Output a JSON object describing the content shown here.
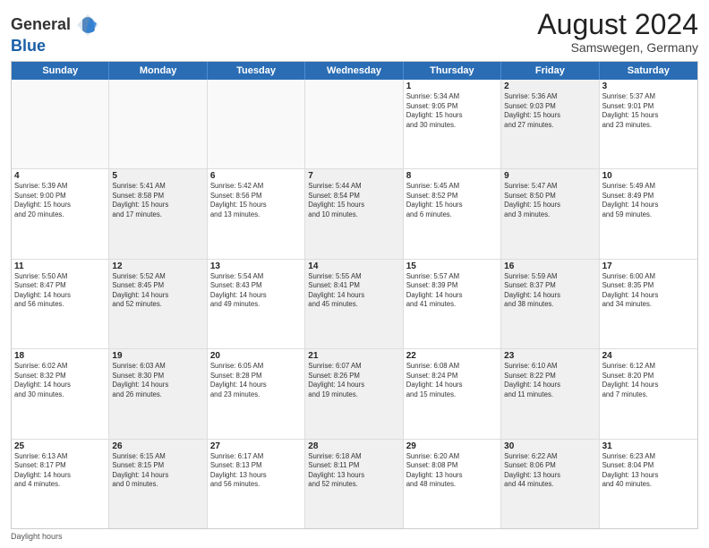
{
  "header": {
    "logo_general": "General",
    "logo_blue": "Blue",
    "month_year": "August 2024",
    "location": "Samswegen, Germany"
  },
  "days": [
    "Sunday",
    "Monday",
    "Tuesday",
    "Wednesday",
    "Thursday",
    "Friday",
    "Saturday"
  ],
  "weeks": [
    [
      {
        "day": "",
        "info": "",
        "shaded": false,
        "empty": true
      },
      {
        "day": "",
        "info": "",
        "shaded": false,
        "empty": true
      },
      {
        "day": "",
        "info": "",
        "shaded": false,
        "empty": true
      },
      {
        "day": "",
        "info": "",
        "shaded": false,
        "empty": true
      },
      {
        "day": "1",
        "info": "Sunrise: 5:34 AM\nSunset: 9:05 PM\nDaylight: 15 hours\nand 30 minutes.",
        "shaded": false,
        "empty": false
      },
      {
        "day": "2",
        "info": "Sunrise: 5:36 AM\nSunset: 9:03 PM\nDaylight: 15 hours\nand 27 minutes.",
        "shaded": true,
        "empty": false
      },
      {
        "day": "3",
        "info": "Sunrise: 5:37 AM\nSunset: 9:01 PM\nDaylight: 15 hours\nand 23 minutes.",
        "shaded": false,
        "empty": false
      }
    ],
    [
      {
        "day": "4",
        "info": "Sunrise: 5:39 AM\nSunset: 9:00 PM\nDaylight: 15 hours\nand 20 minutes.",
        "shaded": false,
        "empty": false
      },
      {
        "day": "5",
        "info": "Sunrise: 5:41 AM\nSunset: 8:58 PM\nDaylight: 15 hours\nand 17 minutes.",
        "shaded": true,
        "empty": false
      },
      {
        "day": "6",
        "info": "Sunrise: 5:42 AM\nSunset: 8:56 PM\nDaylight: 15 hours\nand 13 minutes.",
        "shaded": false,
        "empty": false
      },
      {
        "day": "7",
        "info": "Sunrise: 5:44 AM\nSunset: 8:54 PM\nDaylight: 15 hours\nand 10 minutes.",
        "shaded": true,
        "empty": false
      },
      {
        "day": "8",
        "info": "Sunrise: 5:45 AM\nSunset: 8:52 PM\nDaylight: 15 hours\nand 6 minutes.",
        "shaded": false,
        "empty": false
      },
      {
        "day": "9",
        "info": "Sunrise: 5:47 AM\nSunset: 8:50 PM\nDaylight: 15 hours\nand 3 minutes.",
        "shaded": true,
        "empty": false
      },
      {
        "day": "10",
        "info": "Sunrise: 5:49 AM\nSunset: 8:49 PM\nDaylight: 14 hours\nand 59 minutes.",
        "shaded": false,
        "empty": false
      }
    ],
    [
      {
        "day": "11",
        "info": "Sunrise: 5:50 AM\nSunset: 8:47 PM\nDaylight: 14 hours\nand 56 minutes.",
        "shaded": false,
        "empty": false
      },
      {
        "day": "12",
        "info": "Sunrise: 5:52 AM\nSunset: 8:45 PM\nDaylight: 14 hours\nand 52 minutes.",
        "shaded": true,
        "empty": false
      },
      {
        "day": "13",
        "info": "Sunrise: 5:54 AM\nSunset: 8:43 PM\nDaylight: 14 hours\nand 49 minutes.",
        "shaded": false,
        "empty": false
      },
      {
        "day": "14",
        "info": "Sunrise: 5:55 AM\nSunset: 8:41 PM\nDaylight: 14 hours\nand 45 minutes.",
        "shaded": true,
        "empty": false
      },
      {
        "day": "15",
        "info": "Sunrise: 5:57 AM\nSunset: 8:39 PM\nDaylight: 14 hours\nand 41 minutes.",
        "shaded": false,
        "empty": false
      },
      {
        "day": "16",
        "info": "Sunrise: 5:59 AM\nSunset: 8:37 PM\nDaylight: 14 hours\nand 38 minutes.",
        "shaded": true,
        "empty": false
      },
      {
        "day": "17",
        "info": "Sunrise: 6:00 AM\nSunset: 8:35 PM\nDaylight: 14 hours\nand 34 minutes.",
        "shaded": false,
        "empty": false
      }
    ],
    [
      {
        "day": "18",
        "info": "Sunrise: 6:02 AM\nSunset: 8:32 PM\nDaylight: 14 hours\nand 30 minutes.",
        "shaded": false,
        "empty": false
      },
      {
        "day": "19",
        "info": "Sunrise: 6:03 AM\nSunset: 8:30 PM\nDaylight: 14 hours\nand 26 minutes.",
        "shaded": true,
        "empty": false
      },
      {
        "day": "20",
        "info": "Sunrise: 6:05 AM\nSunset: 8:28 PM\nDaylight: 14 hours\nand 23 minutes.",
        "shaded": false,
        "empty": false
      },
      {
        "day": "21",
        "info": "Sunrise: 6:07 AM\nSunset: 8:26 PM\nDaylight: 14 hours\nand 19 minutes.",
        "shaded": true,
        "empty": false
      },
      {
        "day": "22",
        "info": "Sunrise: 6:08 AM\nSunset: 8:24 PM\nDaylight: 14 hours\nand 15 minutes.",
        "shaded": false,
        "empty": false
      },
      {
        "day": "23",
        "info": "Sunrise: 6:10 AM\nSunset: 8:22 PM\nDaylight: 14 hours\nand 11 minutes.",
        "shaded": true,
        "empty": false
      },
      {
        "day": "24",
        "info": "Sunrise: 6:12 AM\nSunset: 8:20 PM\nDaylight: 14 hours\nand 7 minutes.",
        "shaded": false,
        "empty": false
      }
    ],
    [
      {
        "day": "25",
        "info": "Sunrise: 6:13 AM\nSunset: 8:17 PM\nDaylight: 14 hours\nand 4 minutes.",
        "shaded": false,
        "empty": false
      },
      {
        "day": "26",
        "info": "Sunrise: 6:15 AM\nSunset: 8:15 PM\nDaylight: 14 hours\nand 0 minutes.",
        "shaded": true,
        "empty": false
      },
      {
        "day": "27",
        "info": "Sunrise: 6:17 AM\nSunset: 8:13 PM\nDaylight: 13 hours\nand 56 minutes.",
        "shaded": false,
        "empty": false
      },
      {
        "day": "28",
        "info": "Sunrise: 6:18 AM\nSunset: 8:11 PM\nDaylight: 13 hours\nand 52 minutes.",
        "shaded": true,
        "empty": false
      },
      {
        "day": "29",
        "info": "Sunrise: 6:20 AM\nSunset: 8:08 PM\nDaylight: 13 hours\nand 48 minutes.",
        "shaded": false,
        "empty": false
      },
      {
        "day": "30",
        "info": "Sunrise: 6:22 AM\nSunset: 8:06 PM\nDaylight: 13 hours\nand 44 minutes.",
        "shaded": true,
        "empty": false
      },
      {
        "day": "31",
        "info": "Sunrise: 6:23 AM\nSunset: 8:04 PM\nDaylight: 13 hours\nand 40 minutes.",
        "shaded": false,
        "empty": false
      }
    ]
  ],
  "footer": {
    "daylight_label": "Daylight hours"
  }
}
